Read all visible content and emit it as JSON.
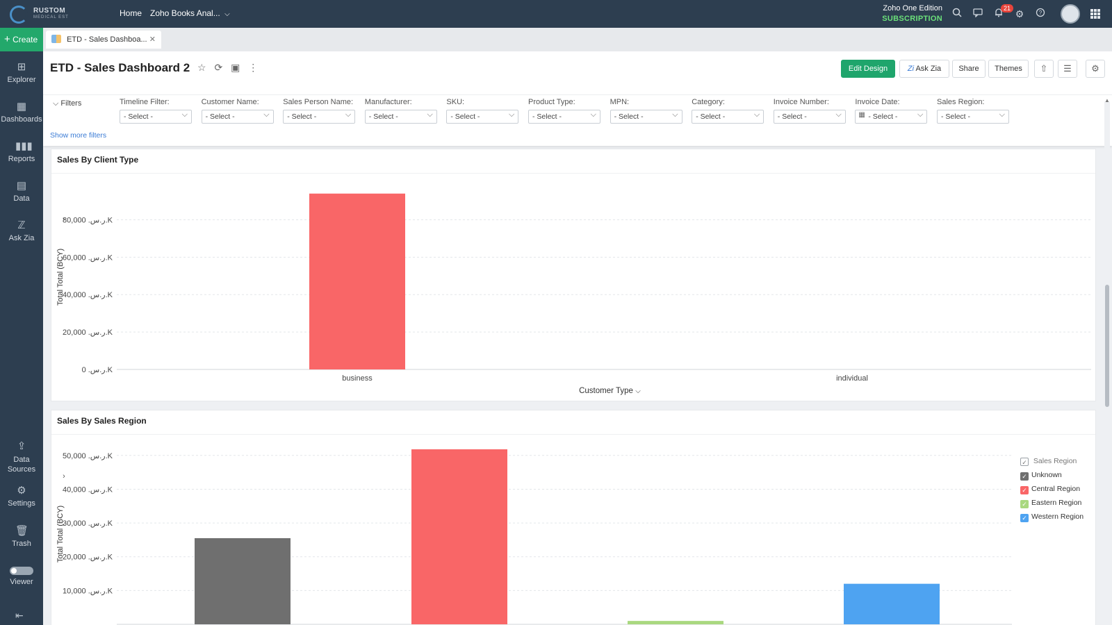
{
  "topbar": {
    "logo_line1": "RUSTOM",
    "logo_line2": "MEDICAL EST",
    "home": "Home",
    "workspace": "Zoho Books Anal...",
    "edition": "Zoho One Edition",
    "subscription": "SUBSCRIPTION",
    "notification_count": "21",
    "icons": [
      "search-icon",
      "chat-icon",
      "bell-icon",
      "gear-icon",
      "help-icon",
      "avatar",
      "apps-grid-icon"
    ]
  },
  "sidebar": {
    "create": "Create",
    "items": [
      {
        "label": "Explorer",
        "icon": "explorer-icon"
      },
      {
        "label": "Dashboards",
        "icon": "dashboards-icon"
      },
      {
        "label": "Reports",
        "icon": "reports-icon"
      },
      {
        "label": "Data",
        "icon": "data-icon"
      },
      {
        "label": "Ask Zia",
        "icon": "zia-icon"
      },
      {
        "label": "Data Sources",
        "icon": "data-sources-icon"
      },
      {
        "label": "Settings",
        "icon": "settings-icon"
      },
      {
        "label": "Trash",
        "icon": "trash-icon"
      },
      {
        "label": "Viewer",
        "icon": "toggle-icon"
      }
    ],
    "toggle_text": "OFF"
  },
  "tab": {
    "label": "ETD - Sales Dashboa..."
  },
  "header": {
    "title": "ETD - Sales Dashboard 2",
    "edit_design": "Edit Design",
    "ask_zia": "Ask Zia",
    "share": "Share",
    "themes": "Themes"
  },
  "filters": {
    "toggle_label": "Filters",
    "show_more": "Show more filters",
    "items": [
      {
        "label": "Timeline Filter:",
        "value": "- Select -"
      },
      {
        "label": "Customer Name:",
        "value": "- Select -"
      },
      {
        "label": "Sales Person Name:",
        "value": "- Select -"
      },
      {
        "label": "Manufacturer:",
        "value": "- Select -"
      },
      {
        "label": "SKU:",
        "value": "- Select -"
      },
      {
        "label": "Product Type:",
        "value": "- Select -"
      },
      {
        "label": "MPN:",
        "value": "- Select -"
      },
      {
        "label": "Category:",
        "value": "- Select -"
      },
      {
        "label": "Invoice Number:",
        "value": "- Select -"
      },
      {
        "label": "Invoice Date:",
        "value": "- Select -"
      },
      {
        "label": "Sales Region:",
        "value": "- Select -"
      }
    ]
  },
  "chart_data": [
    {
      "type": "bar",
      "title": "Sales By Client Type",
      "xlabel": "Customer Type",
      "ylabel": "Total Total (BCY)",
      "categories": [
        "business",
        "individual"
      ],
      "values": [
        94000,
        0
      ],
      "ylim": [
        0,
        100000
      ],
      "yticks": [
        0,
        20000,
        40000,
        60000,
        80000
      ],
      "ytick_labels": [
        "0 .ر.س.K",
        "20,000 .ر.س.K",
        "40,000 .ر.س.K",
        "60,000 .ر.س.K",
        "80,000 .ر.س.K"
      ],
      "color": "#f96667",
      "grid": true
    },
    {
      "type": "bar",
      "title": "Sales By Sales Region",
      "ylabel": "Total Total (BCY)",
      "categories": [
        "Unknown",
        "Central Region",
        "Eastern Region",
        "Western Region"
      ],
      "values": [
        25500,
        52200,
        1000,
        12000
      ],
      "colors": [
        "#6f6f6f",
        "#f96667",
        "#a9d87f",
        "#4ea3f1"
      ],
      "ylim": [
        0,
        55000
      ],
      "yticks": [
        10000,
        20000,
        30000,
        40000,
        50000
      ],
      "ytick_labels": [
        "10,000 .ر.س.K",
        "20,000 .ر.س.K",
        "30,000 .ر.س.K",
        "40,000 .ر.س.K",
        "50,000 .ر.س.K"
      ],
      "legend_title": "Sales Region",
      "legend_position": "top-right",
      "grid": true
    }
  ]
}
